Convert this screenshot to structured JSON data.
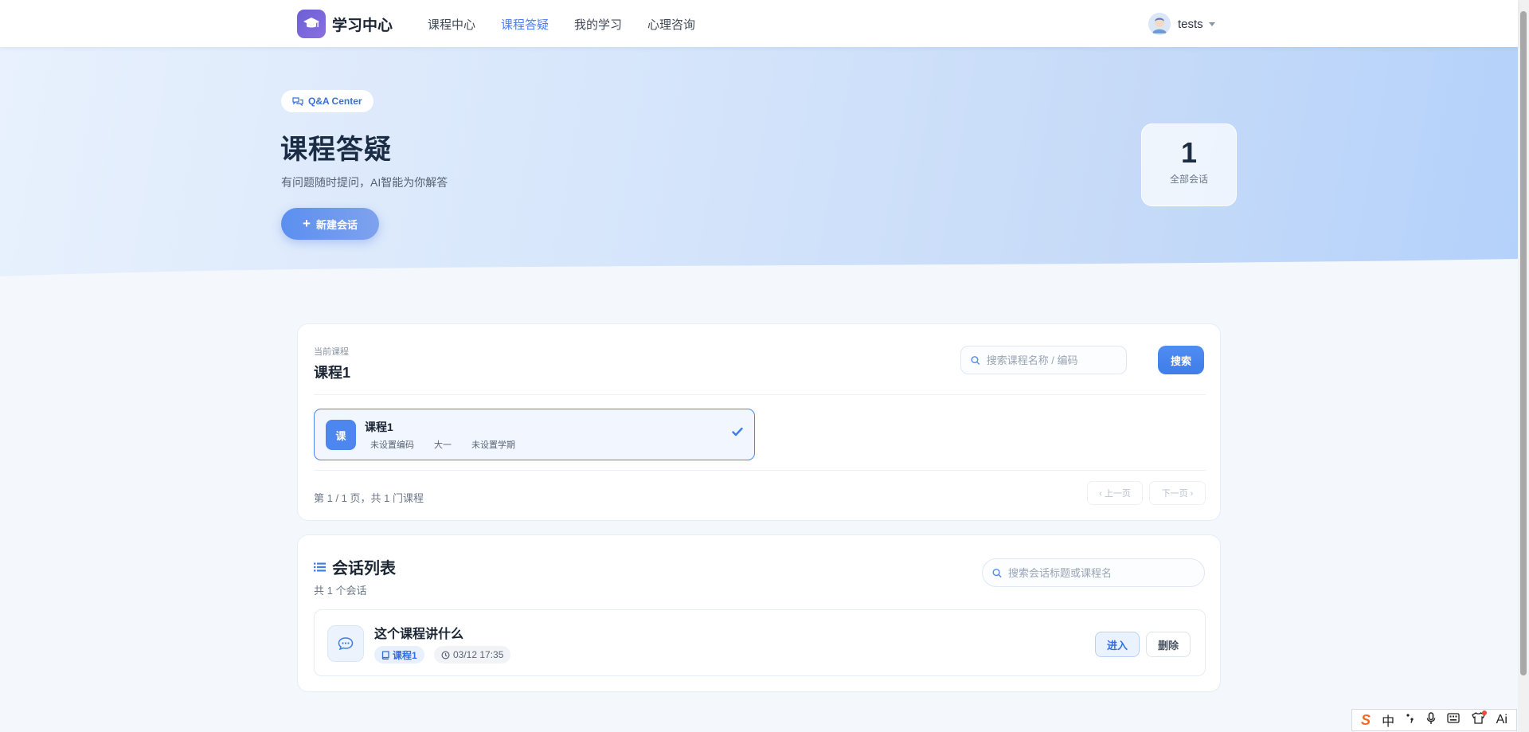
{
  "nav": {
    "brand": "学习中心",
    "links": [
      "课程中心",
      "课程答疑",
      "我的学习",
      "心理咨询"
    ],
    "active_index": 1,
    "user_name": "tests"
  },
  "hero": {
    "badge": "Q&A Center",
    "title": "课程答疑",
    "subtitle": "有问题随时提问，AI智能为你解答",
    "new_button": "新建会话",
    "stat_value": "1",
    "stat_label": "全部会话"
  },
  "course_panel": {
    "current_label": "当前课程",
    "current_course": "课程1",
    "search_placeholder": "搜索课程名称 / 编码",
    "search_button": "搜索",
    "items": [
      {
        "icon_text": "课",
        "name": "课程1",
        "code": "未设置编码",
        "grade": "大一",
        "semester": "未设置学期",
        "selected": true
      }
    ],
    "page_info": "第 1 / 1 页，共 1 门课程",
    "prev_button": "‹ 上一页",
    "next_button": "下一页 ›"
  },
  "conversation_panel": {
    "title": "会话列表",
    "count": "共 1 个会话",
    "search_placeholder": "搜索会话标题或课程名",
    "items": [
      {
        "title": "这个课程讲什么",
        "course_tag": "课程1",
        "time": "03/12 17:35",
        "enter_button": "进入",
        "delete_button": "删除"
      }
    ]
  },
  "ime": {
    "logo": "S",
    "mode": "中",
    "ai": "Ai"
  },
  "colors": {
    "accent": "#4d7ff0",
    "primary_button": "#4f8cf2",
    "brand_logo": "#6a5fd6",
    "hero_gradient_end": "#b4d1fb"
  }
}
